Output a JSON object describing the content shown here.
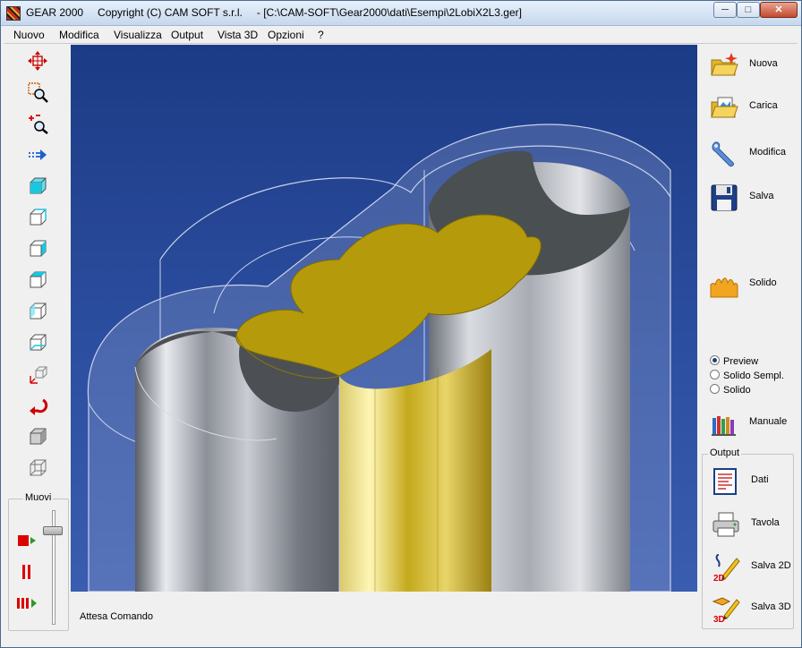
{
  "window": {
    "app_name": "GEAR 2000",
    "copyright": "Copyright (C)  CAM SOFT s.r.l.",
    "file_path": "- [C:\\CAM-SOFT\\Gear2000\\dati\\Esempi\\2LobiX2L3.ger]",
    "min_glyph": "─",
    "max_glyph": "□",
    "close_glyph": "✕"
  },
  "menu": [
    "Nuovo",
    "Modifica",
    "Visualizza",
    "Output",
    "Vista 3D",
    "Opzioni",
    "?"
  ],
  "left_toolbar": {
    "icons": [
      "move-view-icon",
      "zoom-window-icon",
      "zoom-in-out-icon",
      "pan-arrow-icon",
      "view-iso-icon",
      "view-front-icon",
      "view-right-icon",
      "view-top-icon",
      "view-left-icon",
      "view-back-icon",
      "axes-icon",
      "undo-icon",
      "solid-box-icon",
      "wireframe-box-icon"
    ]
  },
  "muovi": {
    "label": "Muovi",
    "slider_level": 0.15,
    "buttons": [
      "play-icon",
      "pause-icon",
      "fast-forward-icon"
    ]
  },
  "status": {
    "text": "Attesa Comando"
  },
  "right_panel": {
    "buttons": [
      {
        "label": "Nuova",
        "icon": "new-folder-icon"
      },
      {
        "label": "Carica",
        "icon": "open-folder-icon"
      },
      {
        "label": "Modifica",
        "icon": "wrench-icon"
      },
      {
        "label": "Salva",
        "icon": "floppy-disk-icon"
      },
      {
        "label": "Solido",
        "icon": "gear-profile-icon"
      }
    ],
    "render_modes": [
      {
        "label": "Preview",
        "selected": true
      },
      {
        "label": "Solido Sempl.",
        "selected": false
      },
      {
        "label": "Solido",
        "selected": false
      }
    ],
    "manual_button": {
      "label": "Manuale",
      "icon": "books-icon"
    },
    "output": {
      "title": "Output",
      "buttons": [
        {
          "label": "Dati",
          "icon": "data-document-icon"
        },
        {
          "label": "Tavola",
          "icon": "printer-icon"
        },
        {
          "label": "Salva 2D",
          "icon": "save-2d-icon"
        },
        {
          "label": "Salva 3D",
          "icon": "save-3d-icon"
        }
      ]
    }
  },
  "colors": {
    "viewport_bg": "#2a4a9a",
    "gear_gold": "#c9a916",
    "cylinder_gray": "#a0a4ab",
    "wire": "#c8d2ea"
  }
}
